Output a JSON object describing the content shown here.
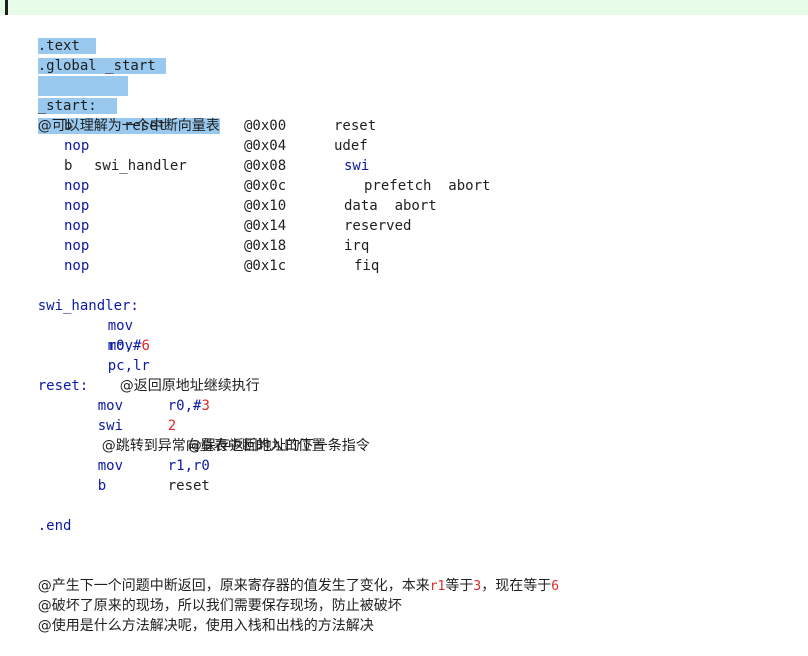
{
  "header_lines": {
    "text": ".text",
    "global": ".global _start",
    "blank": "",
    "start_label": "_start:",
    "vector_comment": "@可以理解为一个中断向量表"
  },
  "vector_table": [
    {
      "instr": "b",
      "arg": "reset",
      "addr": "@0x00",
      "desc": "reset"
    },
    {
      "instr": "nop",
      "arg": "",
      "addr": "@0x04",
      "desc": "udef"
    },
    {
      "instr": "b",
      "arg": "swi_handler",
      "addr": "@0x08",
      "desc": "swi"
    },
    {
      "instr": "nop",
      "arg": "",
      "addr": "@0x0c",
      "desc": "prefetch  abort"
    },
    {
      "instr": "nop",
      "arg": "",
      "addr": "@0x10",
      "desc": "data  abort"
    },
    {
      "instr": "nop",
      "arg": "",
      "addr": "@0x14",
      "desc": "reserved"
    },
    {
      "instr": "nop",
      "arg": "",
      "addr": "@0x18",
      "desc": "irq"
    },
    {
      "instr": "nop",
      "arg": "",
      "addr": "@0x1c",
      "desc": "fiq"
    }
  ],
  "swi_handler": {
    "label": "swi_handler:",
    "line1": {
      "instr": "mov",
      "args": "r0,#",
      "num": "6"
    },
    "line2": {
      "instr": "mov",
      "args": "pc,lr",
      "comment": "@返回原地址继续执行"
    }
  },
  "reset_block": {
    "label": "reset:",
    "line1": {
      "instr": "mov",
      "args": "r0,#",
      "num": "3"
    },
    "line2": {
      "instr": "swi",
      "num": "2",
      "comment": "@跳转到异常向量表中断的入口位置"
    },
    "line3": {
      "comment": "@保存返回地址的下一条指令"
    },
    "line4": {
      "instr": "mov",
      "args": "r1,r0"
    },
    "line5": {
      "instr": "b",
      "args": "reset"
    }
  },
  "end_directive": ".end",
  "notes": {
    "line1_a": "@产生下一个问题中断返回，原来寄存器的值发生了变化，本来",
    "line1_r1": "r1",
    "line1_b": "等于",
    "line1_3": "3",
    "line1_c": "，现在等于",
    "line1_6": "6",
    "line2": "@破坏了原来的现场，所以我们需要保存现场，防止被破坏",
    "line3": "@使用是什么方法解决呢，使用入栈和出栈的方法解决"
  },
  "colors": {
    "selection": "#99c9ef",
    "keyword": "#0b19a8",
    "number": "#d92a2a",
    "top_bar": "#e7fbe9"
  }
}
